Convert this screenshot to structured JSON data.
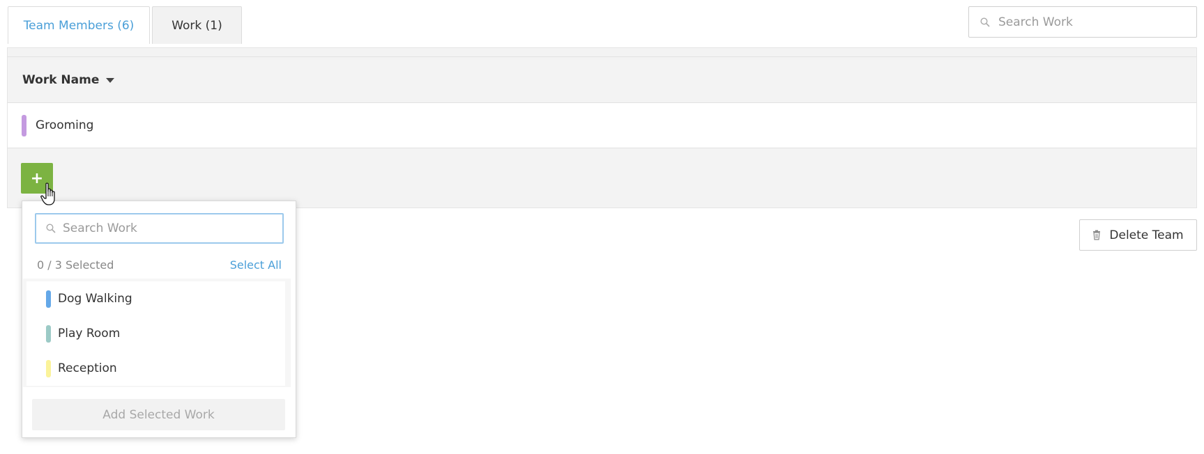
{
  "tabs": [
    {
      "label": "Team Members (6)"
    },
    {
      "label": "Work (1)"
    }
  ],
  "top_search": {
    "placeholder": "Search Work"
  },
  "table": {
    "column_header": "Work Name",
    "rows": [
      {
        "name": "Grooming",
        "color": "#c49ae0"
      }
    ]
  },
  "add_button": {
    "label": "+"
  },
  "delete_team": {
    "label": "Delete Team"
  },
  "dropdown": {
    "search_placeholder": "Search Work",
    "selected_count": "0 / 3 Selected",
    "select_all": "Select All",
    "items": [
      {
        "label": "Dog Walking",
        "color": "#64a8e8"
      },
      {
        "label": "Play Room",
        "color": "#9ccac6"
      },
      {
        "label": "Reception",
        "color": "#fbf39a"
      }
    ],
    "add_selected": "Add Selected Work"
  },
  "colors": {
    "accent_blue": "#4a9fd8",
    "add_green": "#7cb342"
  }
}
